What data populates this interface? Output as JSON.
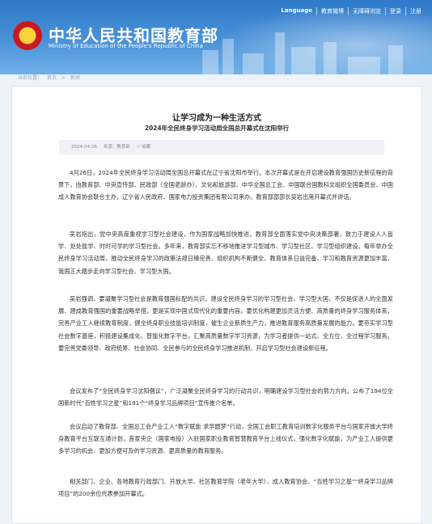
{
  "topnav": [
    "Language",
    "教育微博",
    "无障碍浏览",
    "登录",
    "注册"
  ],
  "site": {
    "name_cn": "中华人民共和国教育部",
    "name_en": "Ministry of Education of the People's Republic of China"
  },
  "breadcrumb": [
    "当前位置：",
    "首页",
    ">",
    "新闻"
  ],
  "article": {
    "title": "让学习成为一种生活方式",
    "subtitle": "2024年全民终身学习活动周全国总开幕式在沈阳举行",
    "date": "2024-04-26",
    "source": "来源：教育部",
    "favorite": "☆ 收藏",
    "paragraphs": [
      "4月26日，2024年全民终身学习活动周全国总开幕式在辽宁省沈阳市举行。本次开幕式是在开启建设教育强国历史新征程的背景下，由教育部、中央宣传部、民政部（全国老龄办）、文化和旅游部、中华全国总工会、中国联合国教科文组织全国委员会、中国成人教育协会联合主办，辽宁省人民政府、国家电力投资集团有限公司承办。教育部部部长吴岩出席开幕式并讲话。",
      "吴岩指出，党中央高度重视学习型社会建设，作为国家战略加快推进。教育部全面落实党中央决策部署，致力于建设人人皆学、处处能学、时时可学的学习型社会。多年来，教育部实忘不移地推进学习型城市、学习型社区、学习型组织建设，每年举办全民终身学习活动周，推动全民终身学习的政策法规日臻完善、组织机构不断健全、教育体系日益完备、学习和教育资源更加丰富，我国正大踏步走向学习型社会、学习型大国。",
      "吴岩强调，要凝聚学习型社会是教育强国标配的共识，建设全民终身学习的学习型社会、学习型大国，不仅是促进人的全面发展、建成教育强国的重要战略举措，更是实现中国式现代化的重要内容。要优化构建更加灵活方便、高质量的终身学习服务体系，完善产业工人继续教育制度，健全终身职业技能培训制度，催生企业新质生产力，推进教育服务高质量发展的能力。要夯实学习型社会数字基座，积极建设集成化、智能化数字平台，汇聚高质量数字学习资源，为学习者提供一站式、全方位、全过程学习服务。要完善党委领导、政府统筹、社会协同、全民参与的全民终身学习推进机制，开启学习型社会建设新征程。",
      "会议发布了“全民终身学习沈阳倡议”，广泛凝聚全民终身学习的行动共识，明确建设学习型社会的努力方向。公布了194位全国新时代“百姓学习之星”和191个“终身学习品牌项目”宣传推介名单。",
      "会议启动了教育部、全国总工会产业工人“数字赋能 求学圆梦”行动，全国工会职工教育培训数字化服务平台与国家开放大学终身教育平台互联互通计划，首家央企（国家电投）入驻国家职业教育智慧教育平台上线仪式，强化数字化赋能，为产业工人提供更多学习的机会、更加方便可及的学习资源、更高质量的教育服务。",
      "相关部门、企业、各地教育行政部门、开放大学、社区教育学院（老年大学）、成人教育协会、“百姓学习之星”“终身学习品牌项目”的200余位代表参加开幕式。"
    ]
  }
}
